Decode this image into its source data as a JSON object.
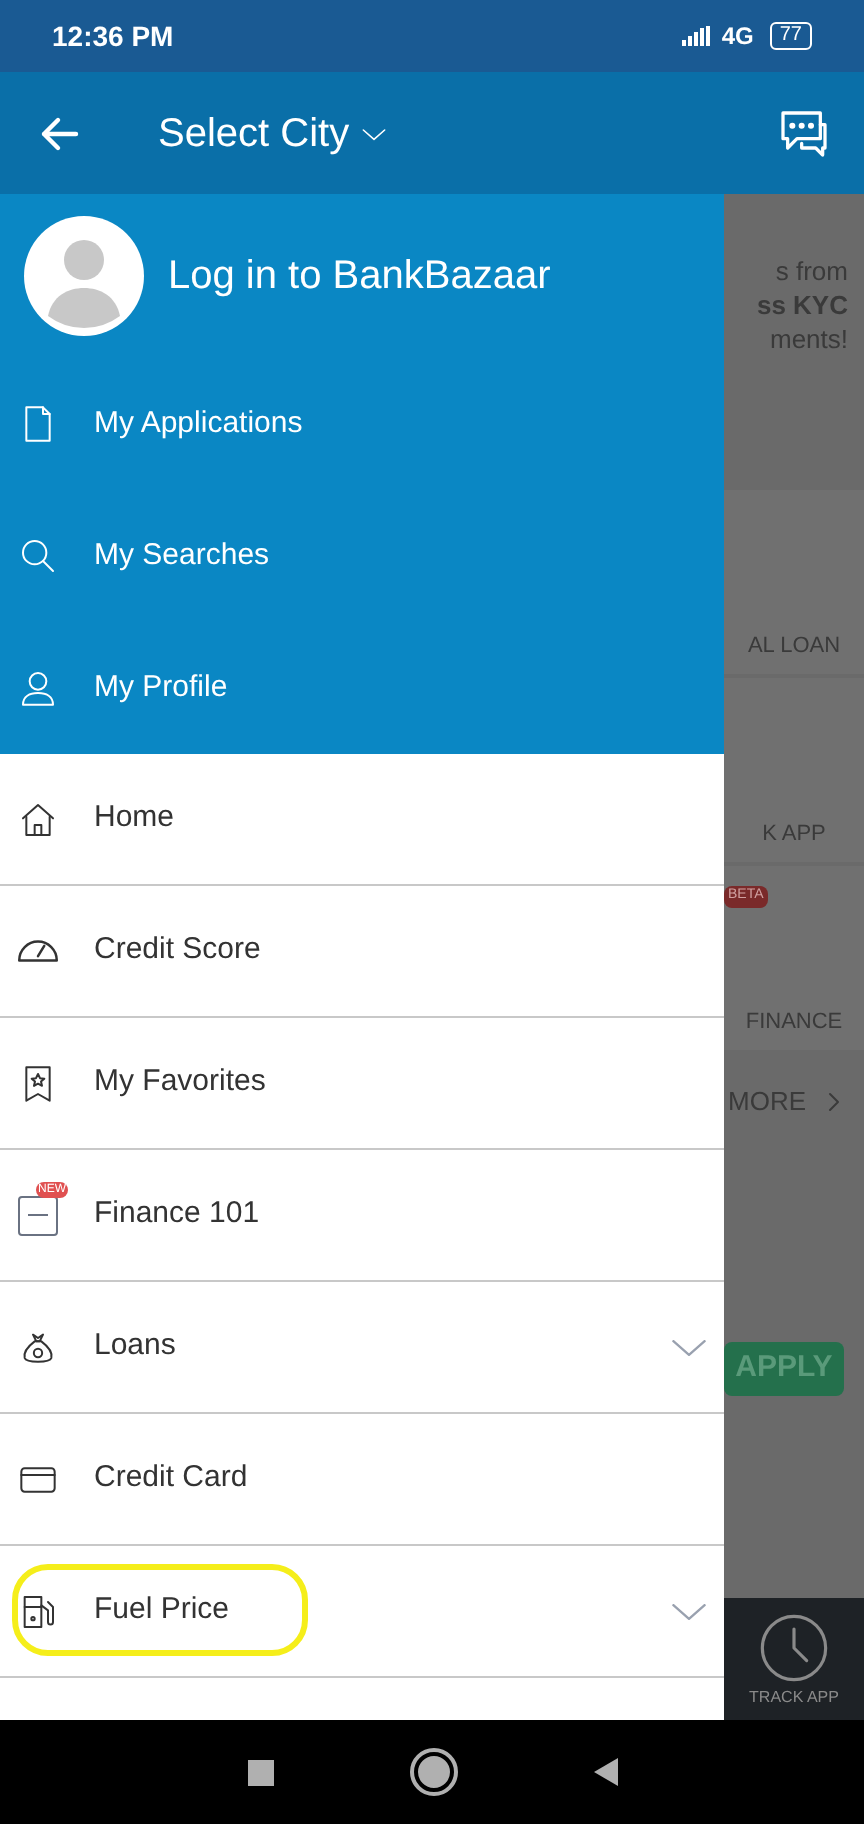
{
  "status_bar": {
    "time": "12:36 PM",
    "network": "4G",
    "battery": "77"
  },
  "header": {
    "title": "Select City"
  },
  "drawer": {
    "login": "Log in to BankBazaar",
    "account_items": [
      {
        "label": "My Applications"
      },
      {
        "label": "My Searches"
      },
      {
        "label": "My Profile"
      }
    ],
    "menu_items": [
      {
        "label": "Home",
        "expandable": false,
        "highlighted": false
      },
      {
        "label": "Credit Score",
        "expandable": false,
        "highlighted": false
      },
      {
        "label": "My Favorites",
        "expandable": false,
        "highlighted": false
      },
      {
        "label": "Finance 101",
        "expandable": false,
        "highlighted": false,
        "badge": "NEW"
      },
      {
        "label": "Loans",
        "expandable": true,
        "highlighted": false
      },
      {
        "label": "Credit Card",
        "expandable": false,
        "highlighted": false
      },
      {
        "label": "Fuel Price",
        "expandable": true,
        "highlighted": true
      }
    ]
  },
  "background_page": {
    "banner_lines": [
      "s from",
      "ss KYC",
      "ments!"
    ],
    "tiles": [
      {
        "label": "AL LOAN"
      },
      {
        "label": "K APP"
      },
      {
        "label": "FINANCE",
        "badge": "BETA"
      }
    ],
    "more": "MORE",
    "apply": "APPLY",
    "track": "TRACK APP"
  }
}
